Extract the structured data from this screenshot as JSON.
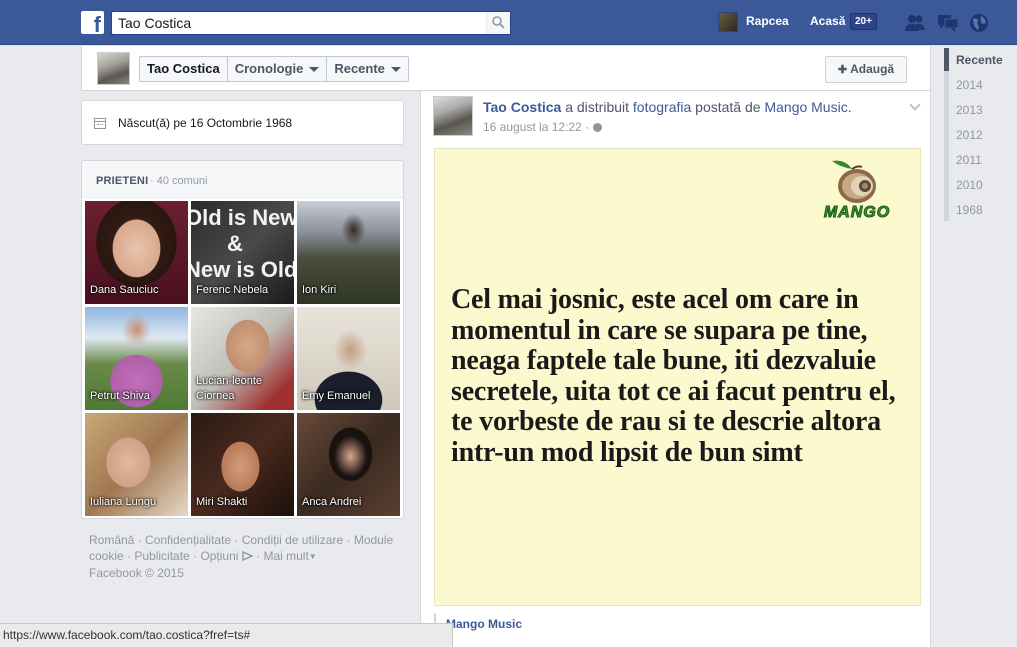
{
  "topbar": {
    "logo_letter": "f",
    "search": {
      "value": "Tao Costica",
      "placeholder": ""
    },
    "user_name": "Rapcea",
    "home_label": "Acasă",
    "home_badge": "20+"
  },
  "profile_bar": {
    "name": "Tao Costica",
    "timeline_label": "Cronologie",
    "recent_label": "Recente",
    "add_label": "Adaugă"
  },
  "timeline_nav": [
    "Recente",
    "2014",
    "2013",
    "2012",
    "2011",
    "2010",
    "1968"
  ],
  "born": {
    "text": "Născut(ă) pe 16 Octombrie 1968"
  },
  "friends": {
    "title": "PRIETENI",
    "count": "· 40 comuni",
    "items": [
      {
        "name": "Dana Sauciuc"
      },
      {
        "name": "Ferenc Nebela"
      },
      {
        "name": "Ion Kiri"
      },
      {
        "name": "Petrut Shiva"
      },
      {
        "name": "Lucian-leonte Ciornea"
      },
      {
        "name": "Emy Emanuel"
      },
      {
        "name": "Iuliana Lungu"
      },
      {
        "name": "Miri Shakti"
      },
      {
        "name": "Anca Andrei"
      }
    ],
    "ferenc_image_text": [
      "Old is New",
      "&",
      "New is Old"
    ]
  },
  "footer": {
    "links": [
      "Română",
      "Confidențialitate",
      "Condiții de utilizare",
      "Module cookie",
      "Publicitate",
      "Opțiuni",
      "Mai mult"
    ],
    "copyright": "Facebook © 2015"
  },
  "post": {
    "author": "Tao Costica",
    "action": "a distribuit",
    "object": "fotografia",
    "posted_by": "postată de",
    "page_name": "Mango Music",
    "period": ".",
    "time": "16 august la 12:22 ·",
    "logo_text": "MANGO",
    "quote": "Cel mai josnic, este acel om care in momentul in care se supara pe tine, neaga faptele tale bune, iti dezvaluie secretele, uita tot ce ai facut pentru el, te vorbeste de rau si te descrie altora intr-un mod lipsit de bun simt",
    "footer_page": "Mango Music"
  },
  "status_bar": {
    "url": "https://www.facebook.com/tao.costica?fref=ts#"
  },
  "colors": {
    "brand": "#3b5998",
    "page_bg": "#e9eaed",
    "quote_bg": "#fbf9cd",
    "mango_green": "#3a9a2e"
  },
  "icons": [
    "search-icon",
    "friend-requests-icon",
    "messages-icon",
    "notifications-globe-icon",
    "calendar-icon",
    "add-friend-icon",
    "privacy-globe-icon",
    "chevron-down-icon",
    "mango-logo"
  ]
}
